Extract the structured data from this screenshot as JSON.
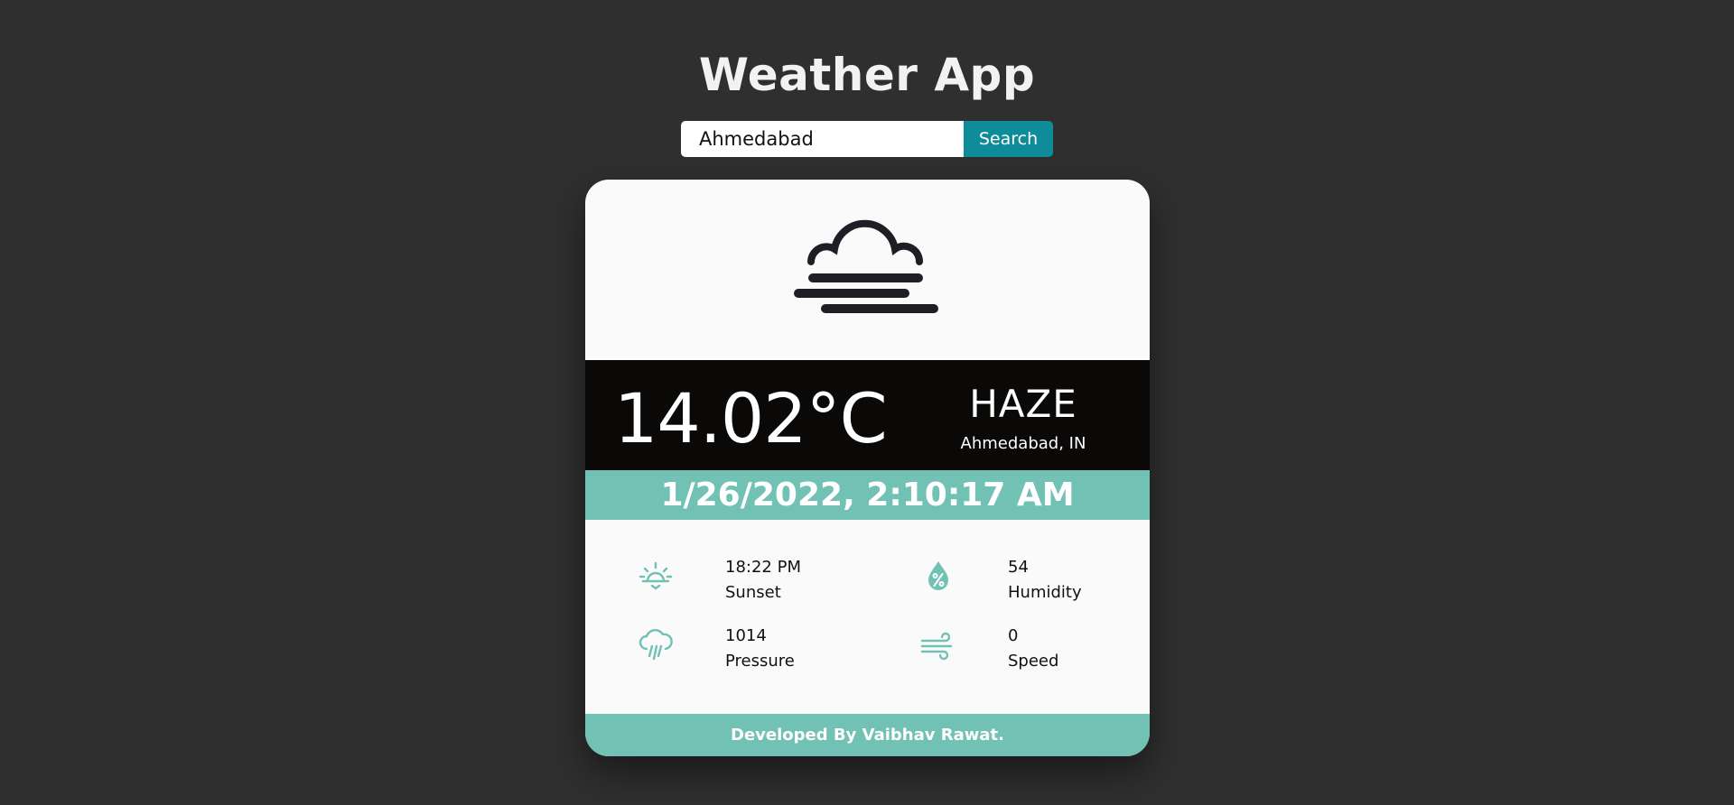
{
  "app": {
    "title": "Weather App"
  },
  "search": {
    "value": "Ahmedabad",
    "button_label": "Search"
  },
  "weather": {
    "temperature": "14.02°C",
    "condition": "HAZE",
    "location": "Ahmedabad, IN",
    "datetime": "1/26/2022, 2:10:17 AM",
    "main_icon": "haze-cloud-icon"
  },
  "details": {
    "sunset": {
      "value": "18:22 PM",
      "label": "Sunset",
      "icon": "sunset-icon"
    },
    "humidity": {
      "value": "54",
      "label": "Humidity",
      "icon": "humidity-drop-icon"
    },
    "pressure": {
      "value": "1014",
      "label": "Pressure",
      "icon": "rain-cloud-icon"
    },
    "speed": {
      "value": "0",
      "label": "Speed",
      "icon": "wind-icon"
    }
  },
  "footer": {
    "text": "Developed By Vaibhav Rawat."
  },
  "colors": {
    "background": "#2f2f2f",
    "accent": "#72c1b5",
    "button": "#0f8c9a",
    "card": "#fafafa",
    "band": "#0a0908"
  }
}
